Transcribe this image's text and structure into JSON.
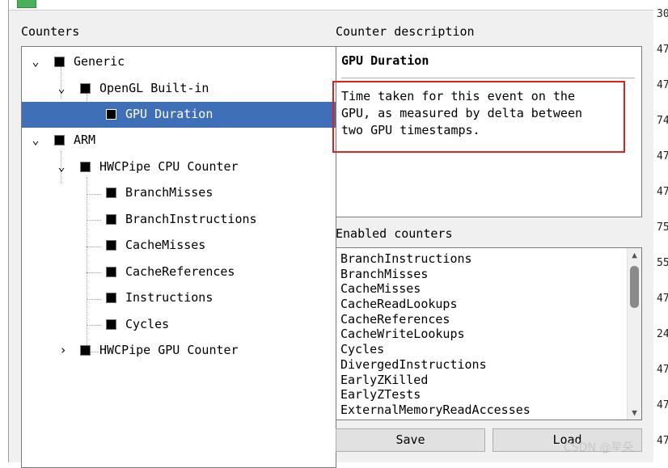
{
  "counters_label": "Counters",
  "desc_label": "Counter description",
  "enabled_label": "Enabled counters",
  "tree": {
    "generic": "Generic",
    "opengl": "OpenGL Built-in",
    "gpu_duration": "GPU Duration",
    "arm": "ARM",
    "hwc_cpu": "HWCPipe CPU Counter",
    "branch_misses": "BranchMisses",
    "branch_instructions": "BranchInstructions",
    "cache_misses": "CacheMisses",
    "cache_references": "CacheReferences",
    "instructions": "Instructions",
    "cycles": "Cycles",
    "hwc_gpu": "HWCPipe GPU Counter"
  },
  "description": {
    "title": "GPU Duration",
    "body": "Time taken for this event on the\nGPU, as measured by delta between\ntwo GPU timestamps."
  },
  "enabled_counters": [
    "BranchInstructions",
    "BranchMisses",
    "CacheMisses",
    "CacheReadLookups",
    "CacheReferences",
    "CacheWriteLookups",
    "Cycles",
    "DivergedInstructions",
    "EarlyZKilled",
    "EarlyZTests",
    "ExternalMemoryReadAccesses"
  ],
  "buttons": {
    "save": "Save",
    "load": "Load"
  },
  "right_strip": [
    "30",
    "47",
    "47",
    "74",
    "47",
    "47",
    "75",
    "55",
    "47",
    "24",
    "47",
    "47",
    "47"
  ],
  "watermark": "CSDN @星朵"
}
